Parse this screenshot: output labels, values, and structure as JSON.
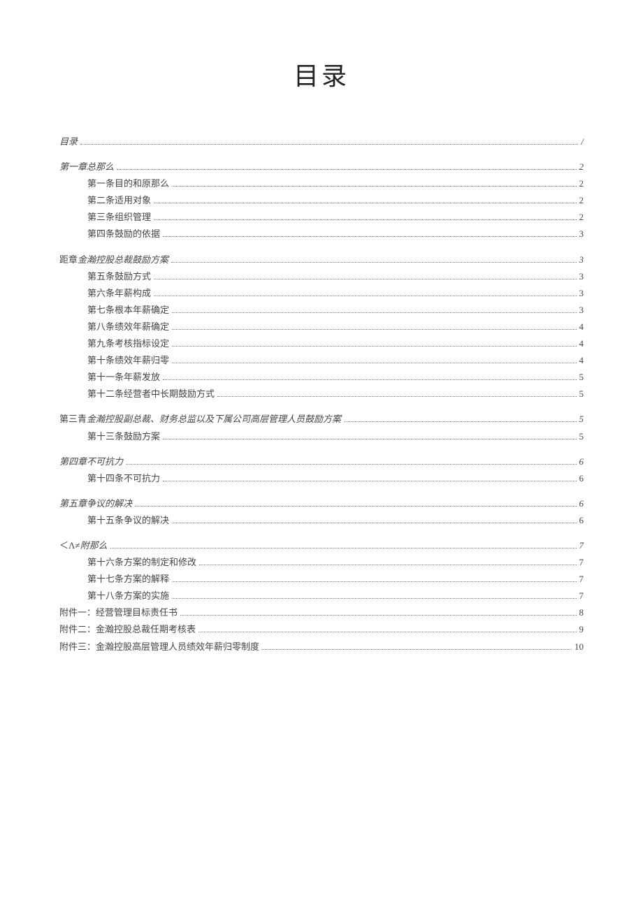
{
  "title": "目录",
  "toc": [
    {
      "group": true,
      "level": 1,
      "italic": true,
      "label": "目录",
      "page": "/"
    },
    {
      "group": true,
      "level": 1,
      "italic": true,
      "label": "第一章总那么",
      "page": "2"
    },
    {
      "level": 2,
      "label": "第一条目的和原那么",
      "page": "2"
    },
    {
      "level": 2,
      "label": "第二条适用对象",
      "page": "2"
    },
    {
      "level": 2,
      "label": "第三条组织管理",
      "page": "2"
    },
    {
      "level": 2,
      "label": "第四条鼓励的依据",
      "page": "3"
    },
    {
      "group": true,
      "level": 1,
      "mixed": true,
      "prefix": "距章",
      "italicLabel": "金瀚控股总裁鼓励方案",
      "page": "3"
    },
    {
      "level": 2,
      "label": "第五条鼓励方式",
      "page": "3"
    },
    {
      "level": 2,
      "label": "第六条年薪构成",
      "page": "3"
    },
    {
      "level": 2,
      "label": "第七条根本年薪确定",
      "page": "3"
    },
    {
      "level": 2,
      "label": "第八条绩效年薪确定",
      "page": "4"
    },
    {
      "level": 2,
      "label": "第九条考核指标设定",
      "page": "4"
    },
    {
      "level": 2,
      "label": "第十条绩效年薪归零",
      "page": "4"
    },
    {
      "level": 2,
      "label": "第十一条年薪发放",
      "page": "5"
    },
    {
      "level": 2,
      "label": "第十二条经营者中长期鼓励方式",
      "page": "5"
    },
    {
      "group": true,
      "level": 1,
      "mixed": true,
      "prefix": "第三青",
      "italicLabel": "金瀚控股副总裁、财务总监以及下属公司高层管理人员鼓励方案",
      "page": "5"
    },
    {
      "level": 2,
      "label": "第十三条鼓励方案",
      "page": "5"
    },
    {
      "group": true,
      "level": 1,
      "italic": true,
      "label": "第四章不可抗力",
      "page": "6"
    },
    {
      "level": 2,
      "label": "第十四条不可抗力",
      "page": "6"
    },
    {
      "group": true,
      "level": 1,
      "italic": true,
      "label": "第五章争议的解决",
      "page": "6"
    },
    {
      "level": 2,
      "label": "第十五条争议的解决",
      "page": "6"
    },
    {
      "group": true,
      "level": 1,
      "mixed": true,
      "prefix": "＜Λ≠",
      "italicLabel": "附那么",
      "page": "7"
    },
    {
      "level": 2,
      "label": "第十六条方案的制定和修改",
      "page": "7"
    },
    {
      "level": 2,
      "label": "第十七条方案的解释",
      "page": "7"
    },
    {
      "level": 2,
      "label": "第十八条方案的实施",
      "page": "7"
    },
    {
      "level": 1,
      "label": "附件一：经营管理目标责任书",
      "page": "8"
    },
    {
      "level": 1,
      "label": "附件二：金瀚控股总裁任期考核表",
      "page": "9"
    },
    {
      "level": 1,
      "label": "附件三：金瀚控股高层管理人员绩效年薪归零制度",
      "page": "10"
    }
  ]
}
